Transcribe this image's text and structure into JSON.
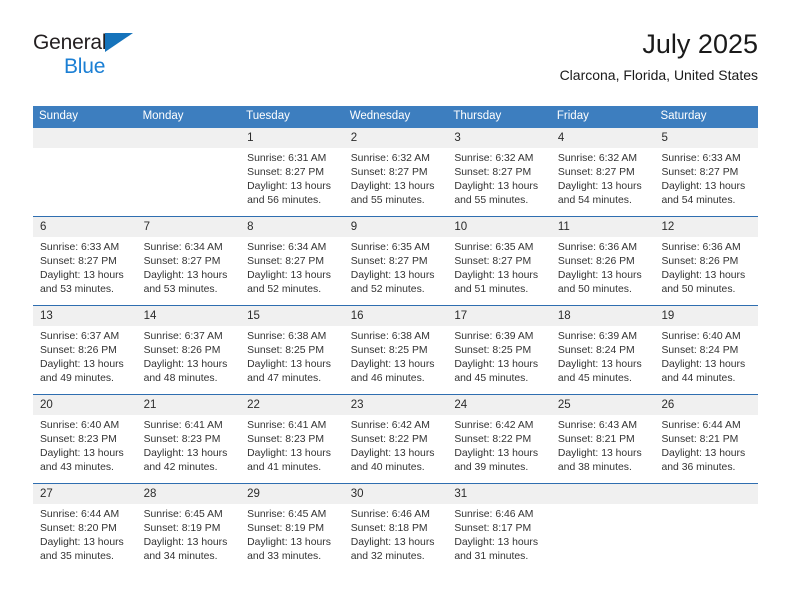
{
  "brand": {
    "line1": "General",
    "line2": "Blue",
    "triangle_color": "#1573bb",
    "blue_text_color": "#1b7fd4"
  },
  "header": {
    "title": "July 2025",
    "subtitle": "Clarcona, Florida, United States"
  },
  "theme": {
    "header_row_bg": "#3d7ebf",
    "week_divider": "#2f6eb0",
    "date_band_bg": "#f0f0f0",
    "text": "#333333"
  },
  "calendar": {
    "day_headers": [
      "Sunday",
      "Monday",
      "Tuesday",
      "Wednesday",
      "Thursday",
      "Friday",
      "Saturday"
    ],
    "weeks": [
      [
        {
          "day": "",
          "lines": []
        },
        {
          "day": "",
          "lines": []
        },
        {
          "day": "1",
          "lines": [
            "Sunrise: 6:31 AM",
            "Sunset: 8:27 PM",
            "Daylight: 13 hours",
            "and 56 minutes."
          ]
        },
        {
          "day": "2",
          "lines": [
            "Sunrise: 6:32 AM",
            "Sunset: 8:27 PM",
            "Daylight: 13 hours",
            "and 55 minutes."
          ]
        },
        {
          "day": "3",
          "lines": [
            "Sunrise: 6:32 AM",
            "Sunset: 8:27 PM",
            "Daylight: 13 hours",
            "and 55 minutes."
          ]
        },
        {
          "day": "4",
          "lines": [
            "Sunrise: 6:32 AM",
            "Sunset: 8:27 PM",
            "Daylight: 13 hours",
            "and 54 minutes."
          ]
        },
        {
          "day": "5",
          "lines": [
            "Sunrise: 6:33 AM",
            "Sunset: 8:27 PM",
            "Daylight: 13 hours",
            "and 54 minutes."
          ]
        }
      ],
      [
        {
          "day": "6",
          "lines": [
            "Sunrise: 6:33 AM",
            "Sunset: 8:27 PM",
            "Daylight: 13 hours",
            "and 53 minutes."
          ]
        },
        {
          "day": "7",
          "lines": [
            "Sunrise: 6:34 AM",
            "Sunset: 8:27 PM",
            "Daylight: 13 hours",
            "and 53 minutes."
          ]
        },
        {
          "day": "8",
          "lines": [
            "Sunrise: 6:34 AM",
            "Sunset: 8:27 PM",
            "Daylight: 13 hours",
            "and 52 minutes."
          ]
        },
        {
          "day": "9",
          "lines": [
            "Sunrise: 6:35 AM",
            "Sunset: 8:27 PM",
            "Daylight: 13 hours",
            "and 52 minutes."
          ]
        },
        {
          "day": "10",
          "lines": [
            "Sunrise: 6:35 AM",
            "Sunset: 8:27 PM",
            "Daylight: 13 hours",
            "and 51 minutes."
          ]
        },
        {
          "day": "11",
          "lines": [
            "Sunrise: 6:36 AM",
            "Sunset: 8:26 PM",
            "Daylight: 13 hours",
            "and 50 minutes."
          ]
        },
        {
          "day": "12",
          "lines": [
            "Sunrise: 6:36 AM",
            "Sunset: 8:26 PM",
            "Daylight: 13 hours",
            "and 50 minutes."
          ]
        }
      ],
      [
        {
          "day": "13",
          "lines": [
            "Sunrise: 6:37 AM",
            "Sunset: 8:26 PM",
            "Daylight: 13 hours",
            "and 49 minutes."
          ]
        },
        {
          "day": "14",
          "lines": [
            "Sunrise: 6:37 AM",
            "Sunset: 8:26 PM",
            "Daylight: 13 hours",
            "and 48 minutes."
          ]
        },
        {
          "day": "15",
          "lines": [
            "Sunrise: 6:38 AM",
            "Sunset: 8:25 PM",
            "Daylight: 13 hours",
            "and 47 minutes."
          ]
        },
        {
          "day": "16",
          "lines": [
            "Sunrise: 6:38 AM",
            "Sunset: 8:25 PM",
            "Daylight: 13 hours",
            "and 46 minutes."
          ]
        },
        {
          "day": "17",
          "lines": [
            "Sunrise: 6:39 AM",
            "Sunset: 8:25 PM",
            "Daylight: 13 hours",
            "and 45 minutes."
          ]
        },
        {
          "day": "18",
          "lines": [
            "Sunrise: 6:39 AM",
            "Sunset: 8:24 PM",
            "Daylight: 13 hours",
            "and 45 minutes."
          ]
        },
        {
          "day": "19",
          "lines": [
            "Sunrise: 6:40 AM",
            "Sunset: 8:24 PM",
            "Daylight: 13 hours",
            "and 44 minutes."
          ]
        }
      ],
      [
        {
          "day": "20",
          "lines": [
            "Sunrise: 6:40 AM",
            "Sunset: 8:23 PM",
            "Daylight: 13 hours",
            "and 43 minutes."
          ]
        },
        {
          "day": "21",
          "lines": [
            "Sunrise: 6:41 AM",
            "Sunset: 8:23 PM",
            "Daylight: 13 hours",
            "and 42 minutes."
          ]
        },
        {
          "day": "22",
          "lines": [
            "Sunrise: 6:41 AM",
            "Sunset: 8:23 PM",
            "Daylight: 13 hours",
            "and 41 minutes."
          ]
        },
        {
          "day": "23",
          "lines": [
            "Sunrise: 6:42 AM",
            "Sunset: 8:22 PM",
            "Daylight: 13 hours",
            "and 40 minutes."
          ]
        },
        {
          "day": "24",
          "lines": [
            "Sunrise: 6:42 AM",
            "Sunset: 8:22 PM",
            "Daylight: 13 hours",
            "and 39 minutes."
          ]
        },
        {
          "day": "25",
          "lines": [
            "Sunrise: 6:43 AM",
            "Sunset: 8:21 PM",
            "Daylight: 13 hours",
            "and 38 minutes."
          ]
        },
        {
          "day": "26",
          "lines": [
            "Sunrise: 6:44 AM",
            "Sunset: 8:21 PM",
            "Daylight: 13 hours",
            "and 36 minutes."
          ]
        }
      ],
      [
        {
          "day": "27",
          "lines": [
            "Sunrise: 6:44 AM",
            "Sunset: 8:20 PM",
            "Daylight: 13 hours",
            "and 35 minutes."
          ]
        },
        {
          "day": "28",
          "lines": [
            "Sunrise: 6:45 AM",
            "Sunset: 8:19 PM",
            "Daylight: 13 hours",
            "and 34 minutes."
          ]
        },
        {
          "day": "29",
          "lines": [
            "Sunrise: 6:45 AM",
            "Sunset: 8:19 PM",
            "Daylight: 13 hours",
            "and 33 minutes."
          ]
        },
        {
          "day": "30",
          "lines": [
            "Sunrise: 6:46 AM",
            "Sunset: 8:18 PM",
            "Daylight: 13 hours",
            "and 32 minutes."
          ]
        },
        {
          "day": "31",
          "lines": [
            "Sunrise: 6:46 AM",
            "Sunset: 8:17 PM",
            "Daylight: 13 hours",
            "and 31 minutes."
          ]
        },
        {
          "day": "",
          "lines": []
        },
        {
          "day": "",
          "lines": []
        }
      ]
    ]
  }
}
